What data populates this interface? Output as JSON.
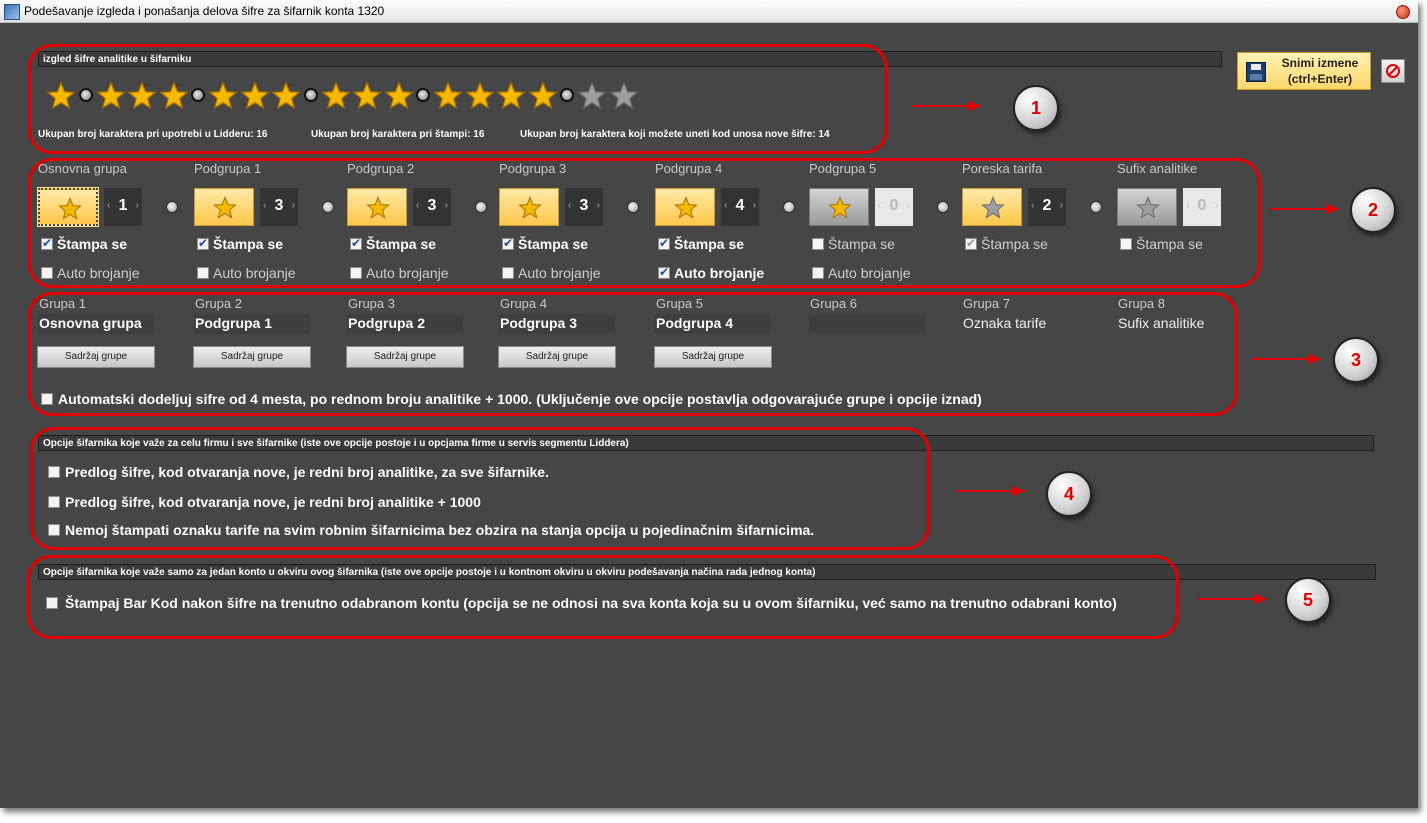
{
  "window": {
    "title": "Podešavanje izgleda i ponašanja delova šifre za šifarnik konta 1320"
  },
  "toolbar": {
    "save_label_line1": "Snimi izmene",
    "save_label_line2": "(ctrl+Enter)"
  },
  "section1": {
    "header": "izgled šifre analitike u šifarniku",
    "info": {
      "usage_label": "Ukupan broj karaktera pri upotrebi u Lidderu:",
      "usage_value": "16",
      "print_label": "Ukupan broj karaktera pri štampi:",
      "print_value": "16",
      "entry_label": "Ukupan broj karaktera koji možete uneti kod unosa nove šifre:",
      "entry_value": "14"
    }
  },
  "groups": [
    {
      "header": "Osnovna grupa",
      "value": "1",
      "stampa": "Štampa se",
      "stampa_checked": true,
      "auto": "Auto brojanje",
      "auto_checked": false
    },
    {
      "header": "Podgrupa 1",
      "value": "3",
      "stampa": "Štampa se",
      "stampa_checked": true,
      "auto": "Auto brojanje",
      "auto_checked": false
    },
    {
      "header": "Podgrupa 2",
      "value": "3",
      "stampa": "Štampa se",
      "stampa_checked": true,
      "auto": "Auto brojanje",
      "auto_checked": false
    },
    {
      "header": "Podgrupa 3",
      "value": "3",
      "stampa": "Štampa se",
      "stampa_checked": true,
      "auto": "Auto brojanje",
      "auto_checked": false
    },
    {
      "header": "Podgrupa 4",
      "value": "4",
      "stampa": "Štampa se",
      "stampa_checked": true,
      "auto": "Auto brojanje",
      "auto_checked": true
    },
    {
      "header": "Podgrupa 5",
      "value": "0",
      "stampa": "Štampa se",
      "stampa_checked": false,
      "auto": "Auto brojanje",
      "auto_checked": false
    },
    {
      "header": "Poreska tarifa",
      "value": "2",
      "stampa": "Štampa se",
      "stampa_checked": true
    },
    {
      "header": "Sufix analitike",
      "value": "0",
      "stampa": "Štampa se",
      "stampa_checked": false
    }
  ],
  "grupe": [
    {
      "header": "Grupa 1",
      "name": "Osnovna grupa",
      "button": "Sadržaj grupe"
    },
    {
      "header": "Grupa 2",
      "name": "Podgrupa 1",
      "button": "Sadržaj grupe"
    },
    {
      "header": "Grupa 3",
      "name": "Podgrupa 2",
      "button": "Sadržaj grupe"
    },
    {
      "header": "Grupa 4",
      "name": "Podgrupa 3",
      "button": "Sadržaj grupe"
    },
    {
      "header": "Grupa 5",
      "name": "Podgrupa 4",
      "button": "Sadržaj grupe"
    },
    {
      "header": "Grupa 6",
      "name": ""
    },
    {
      "header": "Grupa 7",
      "name": "Oznaka tarife"
    },
    {
      "header": "Grupa 8",
      "name": "Sufix analitike"
    }
  ],
  "auto_assign": {
    "label": "Automatski dodeljuj sifre od 4 mesta, po rednom broju analitike + 1000. (Uključenje ove opcije postavlja odgovarajuće grupe i opcije iznad)",
    "checked": false
  },
  "section4": {
    "header": "Opcije šifarnika koje važe za celu firmu i sve šifarnike (iste ove opcije postoje i u opcjama firme u servis segmentu Liddera)",
    "options": [
      {
        "label": "Predlog šifre, kod otvaranja nove, je redni broj analitike, za sve šifarnike.",
        "checked": false
      },
      {
        "label": "Predlog šifre, kod otvaranja nove, je redni broj analitike + 1000",
        "checked": false
      },
      {
        "label": "Nemoj štampati oznaku tarife na svim robnim šifarnicima bez obzira na stanja opcija u pojedinačnim šifarnicima.",
        "checked": false
      }
    ]
  },
  "section5": {
    "header": "Opcije šifarnika koje važe samo za jedan konto u okviru ovog šifarnika  (iste ove opcije postoje i u kontnom okviru u okviru podešavanja načina rada jednog konta)",
    "options": [
      {
        "label": "Štampaj Bar Kod nakon šifre na trenutno odabranom kontu (opcija se ne odnosi na sva konta koja su u ovom šifarniku, već samo na trenutno odabrani konto)",
        "checked": false
      }
    ]
  },
  "badges": [
    "1",
    "2",
    "3",
    "4",
    "5"
  ],
  "colors": {
    "annotation": "#e00000",
    "star_gold": "#f5b800",
    "star_gray": "#9e9e9e",
    "background": "#464646"
  }
}
